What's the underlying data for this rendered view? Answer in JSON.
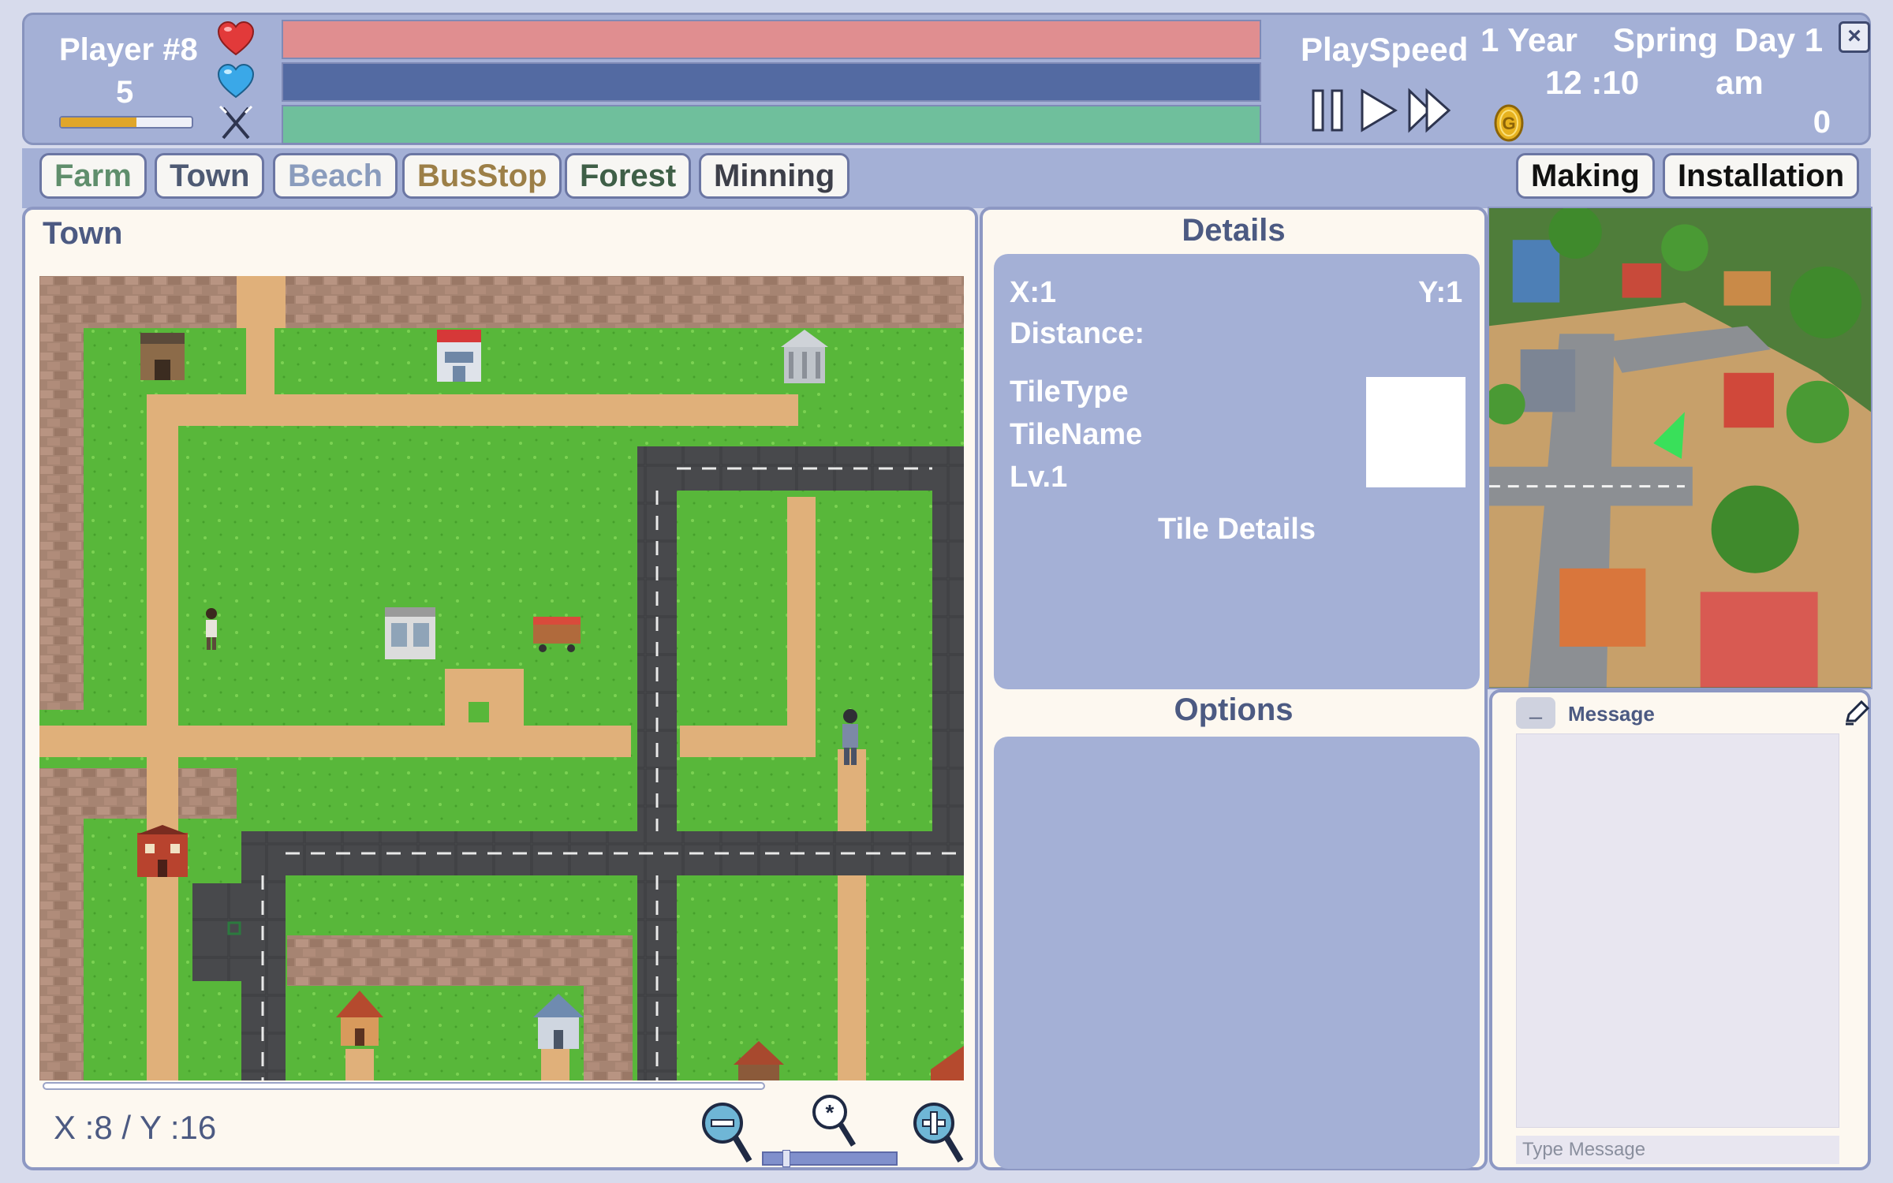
{
  "player": {
    "name": "Player #8",
    "level": "5",
    "xp_fraction": 0.58,
    "stats": [
      {
        "icon": "heart-icon",
        "fraction": 1.0,
        "color": "#e08e90"
      },
      {
        "icon": "mana-heart-icon",
        "fraction": 1.0,
        "color": "#536aa2"
      },
      {
        "icon": "fork-knife-icon",
        "fraction": 1.0,
        "color": "#6fbf9c"
      }
    ]
  },
  "playspeed": {
    "label": "PlaySpeed",
    "buttons": [
      "pause-icon",
      "play-icon",
      "fast-forward-icon"
    ]
  },
  "date": {
    "year": "1 Year",
    "season": "Spring",
    "day": "Day 1",
    "time": "12 :10",
    "ampm": "am"
  },
  "gold": {
    "amount": "0",
    "icon": "gold-coin-icon"
  },
  "close": {
    "label": "×"
  },
  "tabs": [
    {
      "label": "Farm",
      "color": "#5f8e6c"
    },
    {
      "label": "Town",
      "color": "#4e5a73"
    },
    {
      "label": "Beach",
      "color": "#8a9cbd"
    },
    {
      "label": "BusStop",
      "color": "#9c7f47"
    },
    {
      "label": "Forest",
      "color": "#3f5f47"
    },
    {
      "label": "Minning",
      "color": "#3d3f49"
    }
  ],
  "actions": [
    {
      "label": "Making"
    },
    {
      "label": "Installation"
    }
  ],
  "map": {
    "title": "Town",
    "coords": "X :8 / Y :16",
    "zoom_level": 0.15,
    "buildings": [
      "house",
      "hospital",
      "bank",
      "store",
      "shop",
      "school",
      "cottage",
      "villa",
      "cabin"
    ]
  },
  "details": {
    "heading": "Details",
    "x": "X:1",
    "y": "Y:1",
    "distance": "Distance:",
    "tile_type": "TileType",
    "tile_name": "TileName",
    "level": "Lv.1",
    "tile_details": "Tile Details"
  },
  "options": {
    "heading": "Options"
  },
  "message": {
    "minimize": "_",
    "label": "Message",
    "placeholder": "Type Message"
  },
  "colors": {
    "panel_accent": "#a4b0d6",
    "heading_text": "#4c5a82",
    "grass": "#58b73a",
    "dirt_path": "#e0b07a",
    "road": "#48494c",
    "brick": "#a68472"
  }
}
